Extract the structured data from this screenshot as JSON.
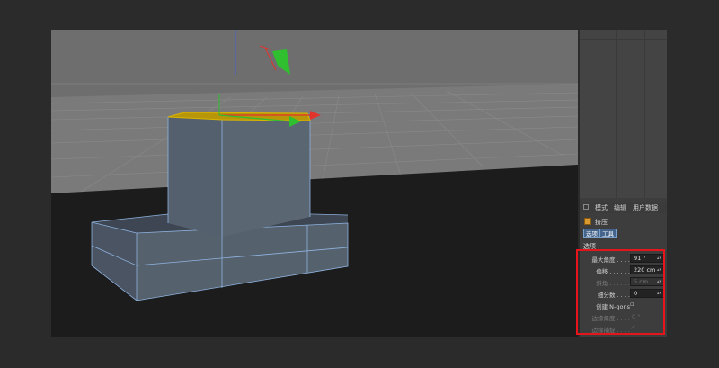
{
  "panel": {
    "menu": {
      "mode": "模式",
      "edit": "编辑",
      "user_data": "用户数据"
    },
    "object_name": "挤压",
    "tabs": [
      "选项",
      "工具"
    ],
    "section_title": "选项",
    "fields": [
      {
        "label": "最大角度 . . . .",
        "value": "91 °",
        "enabled": true
      },
      {
        "label": "偏移 . . . . . .",
        "value": "220 cm",
        "enabled": true
      },
      {
        "label": "斜角 . . . . . .",
        "value": "5 cm",
        "enabled": false
      },
      {
        "label": "细分数 . . . .",
        "value": "0",
        "enabled": true
      }
    ],
    "checks": [
      {
        "label": "创建 N-gons",
        "checked": false,
        "enabled": true
      },
      {
        "label": "边缘角度 . . . .",
        "value": "0 °",
        "enabled": false
      },
      {
        "label": "边缘捕捉 . . . .",
        "checked": true,
        "enabled": false
      }
    ]
  },
  "colors": {
    "highlight": "#e8141b",
    "selected_face": "#c9a400",
    "axis_x": "#e0342c",
    "axis_y": "#2fbf2f",
    "axis_z": "#3b5ae8",
    "mesh_face": "#4c5866",
    "mesh_edge": "#8fb4e0",
    "sky": "#6d6d6d",
    "floor": "#1b1b1b"
  }
}
